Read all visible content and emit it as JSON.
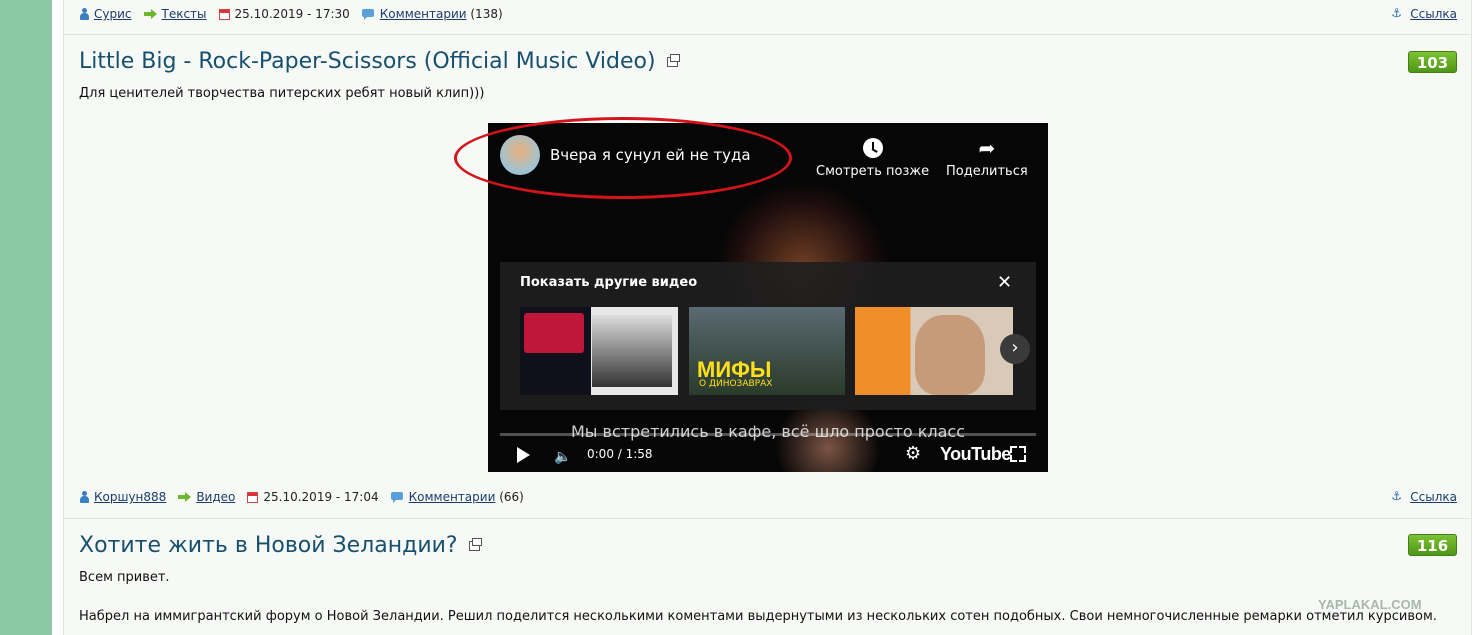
{
  "post1_meta": {
    "author": "Сурис",
    "category": "Тексты",
    "datetime": "25.10.2019 - 17:30",
    "comments_label": "Комментарии",
    "comments_count": "(138)",
    "link_label": "Ссылка"
  },
  "post2": {
    "title": "Little Big - Rock-Paper-Scissors (Official Music Video)",
    "text": "Для ценителей творчества питерских ребят новый клип)))",
    "score": "103",
    "video": {
      "title": "Вчера я сунул ей не туда",
      "watch_later": "Смотреть позже",
      "share": "Поделиться",
      "panel_title": "Показать другие видео",
      "subtitle": "Мы встретились в кафе, всё шло просто класс",
      "time": "0:00 / 1:58",
      "youtube": "YouTube",
      "thumb2_caption": "МИФЫ",
      "thumb2_sub": "О ДИНОЗАВРАХ",
      "progress": 0
    },
    "meta": {
      "author": "Коршун888",
      "category": "Видео",
      "datetime": "25.10.2019 - 17:04",
      "comments_label": "Комментарии",
      "comments_count": "(66)",
      "link_label": "Ссылка"
    }
  },
  "post3": {
    "title": "Хотите жить в Новой Зеландии?",
    "score": "116",
    "text1": "Всем привет.",
    "text2": "Набрел на иммигрантский форум о Новой Зеландии. Решил поделится несколькими коментами выдернутыми из нескольких сотен подобных. Свои немногочисленные ремарки отметил курсивом."
  },
  "watermark": "YAPLAKAL.COM",
  "colors": {
    "score_bg": "#5ea823",
    "title": "#17506e",
    "highlight_ellipse": "#d4141a",
    "sidebar": "#8dc8a4"
  }
}
